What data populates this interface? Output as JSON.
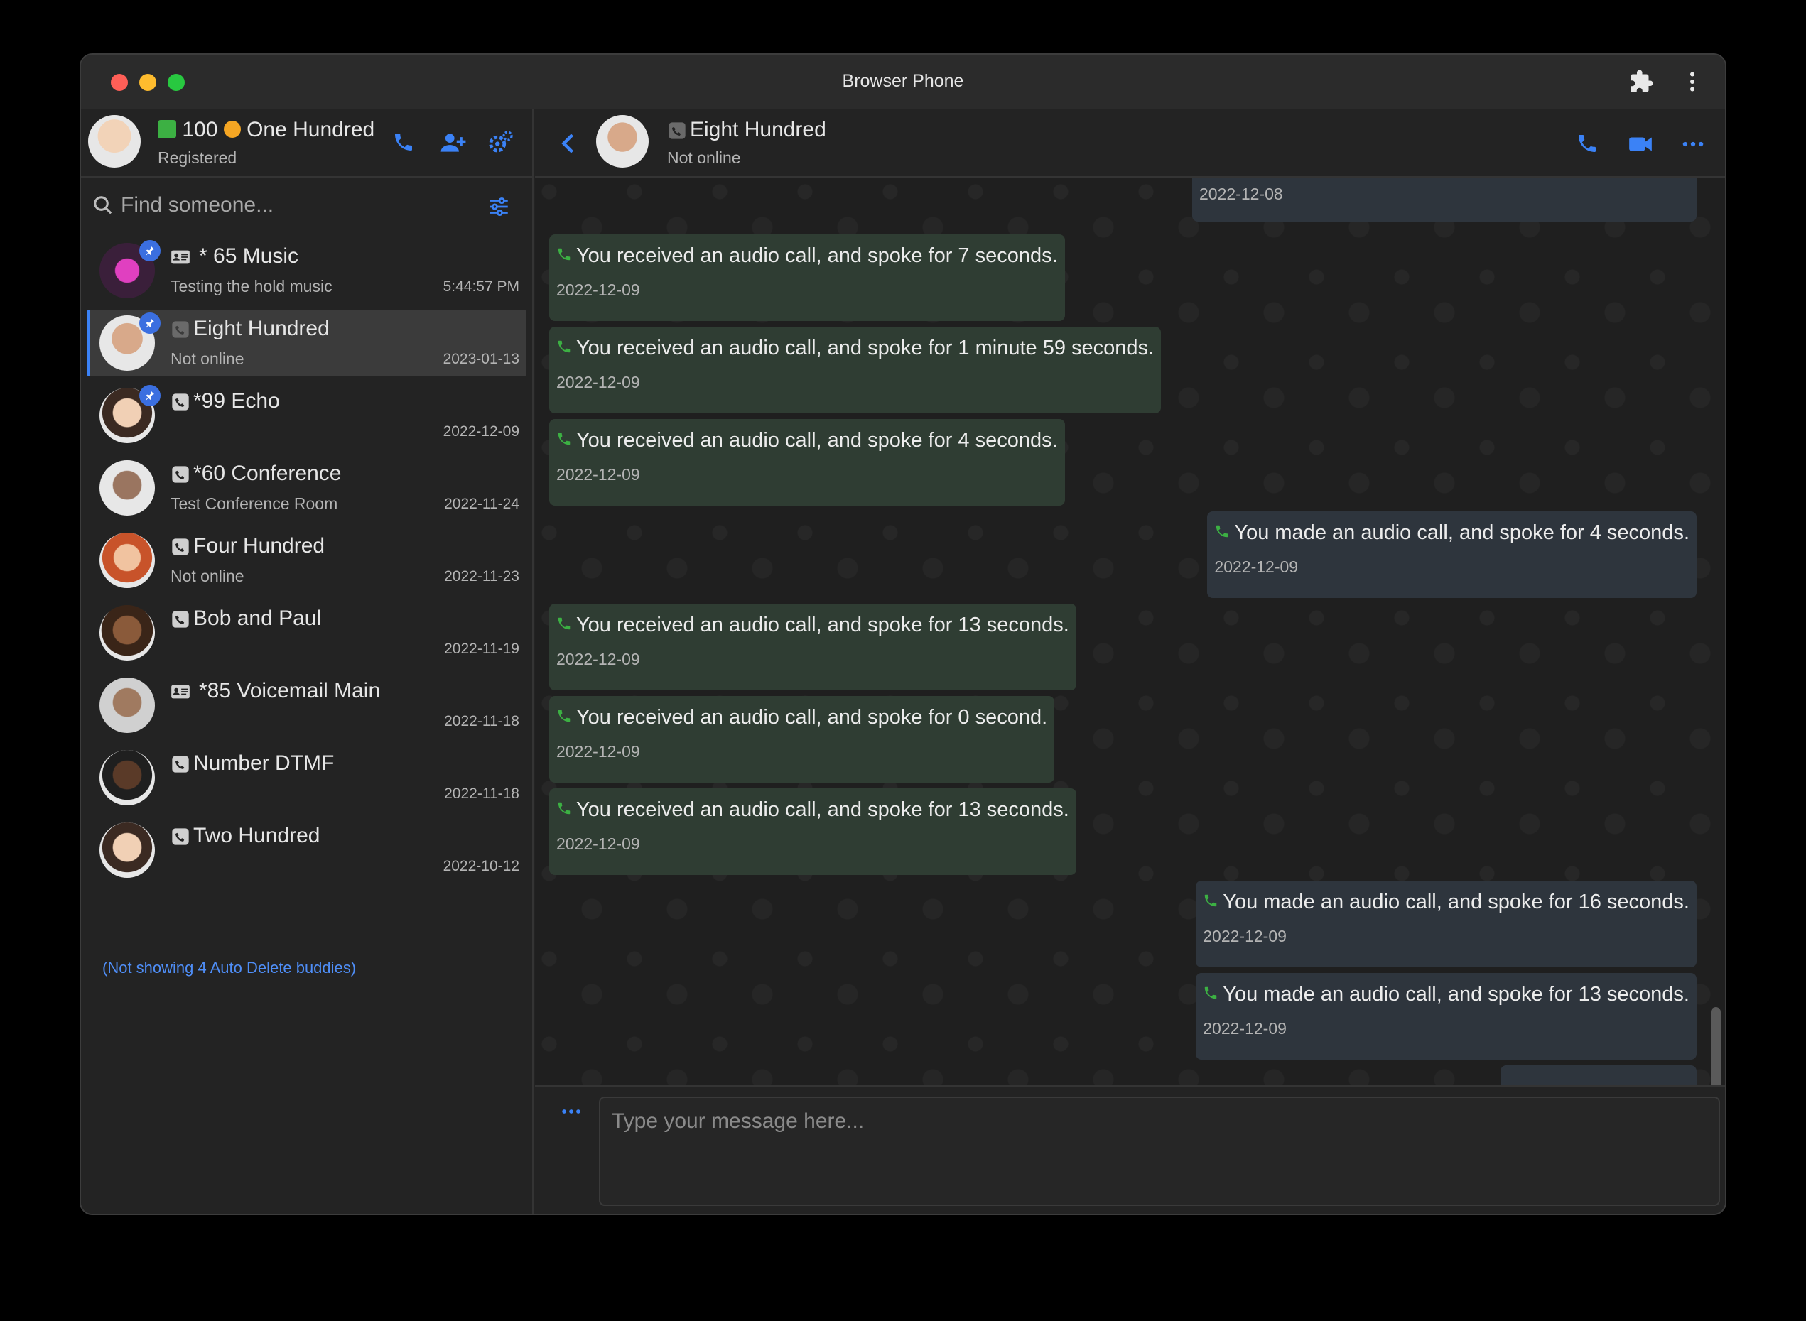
{
  "window": {
    "title": "Browser Phone"
  },
  "profile": {
    "number": "100",
    "name": "One Hundred",
    "status": "Registered"
  },
  "search": {
    "placeholder": "Find someone..."
  },
  "buddies": [
    {
      "name": "* 65 Music",
      "sub": "Testing the hold music",
      "date": "5:44:57 PM",
      "type": "contact",
      "pinned": true
    },
    {
      "name": "Eight Hundred",
      "sub": "Not online",
      "date": "2023-01-13",
      "type": "phone",
      "pinned": true,
      "selected": true
    },
    {
      "name": "*99 Echo",
      "sub": "",
      "date": "2022-12-09",
      "type": "phone",
      "pinned": true
    },
    {
      "name": "*60 Conference",
      "sub": "Test Conference Room",
      "date": "2022-11-24",
      "type": "phone"
    },
    {
      "name": "Four Hundred",
      "sub": "Not online",
      "date": "2022-11-23",
      "type": "phone"
    },
    {
      "name": "Bob and Paul",
      "sub": "",
      "date": "2022-11-19",
      "type": "phone"
    },
    {
      "name": "*85 Voicemail Main",
      "sub": "",
      "date": "2022-11-18",
      "type": "contact"
    },
    {
      "name": "Number DTMF",
      "sub": "",
      "date": "2022-11-18",
      "type": "phone"
    },
    {
      "name": "Two Hundred",
      "sub": "",
      "date": "2022-10-12",
      "type": "phone"
    }
  ],
  "autodelete_note": "(Not showing 4 Auto Delete buddies)",
  "chat": {
    "name": "Eight Hundred",
    "status": "Not online",
    "messages": [
      {
        "text": "",
        "date": "2022-12-08",
        "dir": "out"
      },
      {
        "text": "You received an audio call, and spoke for 7 seconds.",
        "date": "2022-12-09",
        "dir": "in"
      },
      {
        "text": "You received an audio call, and spoke for 1 minute 59 seconds.",
        "date": "2022-12-09",
        "dir": "in"
      },
      {
        "text": "You received an audio call, and spoke for 4 seconds.",
        "date": "2022-12-09",
        "dir": "in"
      },
      {
        "text": "You made an audio call, and spoke for 4 seconds.",
        "date": "2022-12-09",
        "dir": "out"
      },
      {
        "text": "You received an audio call, and spoke for 13 seconds.",
        "date": "2022-12-09",
        "dir": "in"
      },
      {
        "text": "You received an audio call, and spoke for 0 second.",
        "date": "2022-12-09",
        "dir": "in"
      },
      {
        "text": "You received an audio call, and spoke for 13 seconds.",
        "date": "2022-12-09",
        "dir": "in"
      },
      {
        "text": "You made an audio call, and spoke for 16 seconds.",
        "date": "2022-12-09",
        "dir": "out"
      },
      {
        "text": "You made an audio call, and spoke for 13 seconds.",
        "date": "2022-12-09",
        "dir": "out"
      }
    ]
  },
  "composer": {
    "placeholder": "Type your message here..."
  },
  "colors": {
    "accent": "#3b82f6",
    "incoming_bubble": "#2f3d33",
    "outgoing_bubble": "#2e353d",
    "call_icon": "#3cb043",
    "traffic_red": "#ff5f57",
    "traffic_yellow": "#febc2e",
    "traffic_green": "#28c840"
  }
}
